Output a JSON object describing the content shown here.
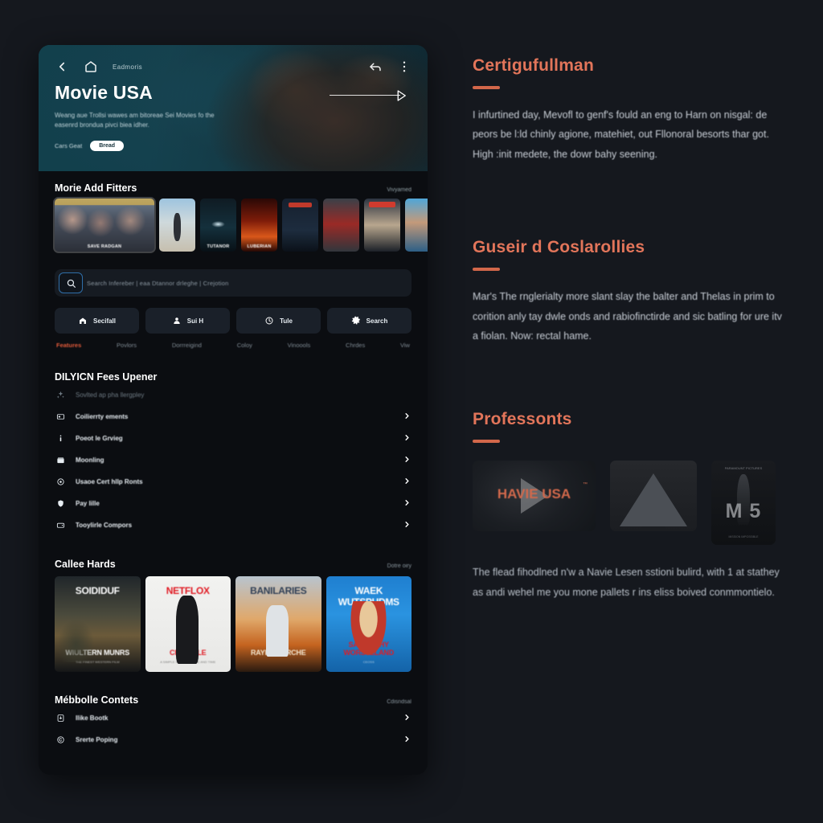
{
  "app": {
    "header": {
      "breadcrumb": "Eadmoris",
      "back_icon": "chevron-left-icon",
      "home_icon": "home-icon",
      "share_icon": "share-icon",
      "more_icon": "more-vertical-icon"
    },
    "hero": {
      "title": "Movie USA",
      "subtitle": "Weang aue Trollsi wawes am bitoreae Sei Movies fo the easenrd brondua pivci biea idher.",
      "meta_text": "Cars Geat",
      "pill_label": "Bread",
      "play_icon": "play-triangle-icon"
    },
    "carousel": {
      "title": "Morie Add Fitters",
      "link": "Vivyamed",
      "items": [
        {
          "id": "t1",
          "caption": "SAVE RADGAN"
        },
        {
          "id": "t2",
          "caption": ""
        },
        {
          "id": "t3",
          "caption": "TUTANOR"
        },
        {
          "id": "t4",
          "caption": "LUBERIAN"
        },
        {
          "id": "t5",
          "caption": ""
        },
        {
          "id": "t6",
          "caption": ""
        },
        {
          "id": "t7",
          "caption": ""
        },
        {
          "id": "t8",
          "caption": ""
        }
      ]
    },
    "search": {
      "icon": "search-icon",
      "placeholder": "Search Infereber  |  eaa Dtannor drleghe   |   Crejotion"
    },
    "quick_actions": [
      {
        "label": "Secifall",
        "icon": "home-icon"
      },
      {
        "label": "Sui H",
        "icon": "user-icon"
      },
      {
        "label": "Tule",
        "icon": "clock-icon"
      },
      {
        "label": "Search",
        "icon": "settings-icon"
      }
    ],
    "tabs": [
      {
        "label": "Features",
        "active": true
      },
      {
        "label": "Povlors",
        "active": false
      },
      {
        "label": "Dorrreigind",
        "active": false
      },
      {
        "label": "Coloy",
        "active": false
      },
      {
        "label": "Vinoools",
        "active": false
      },
      {
        "label": "Chrdes",
        "active": false
      },
      {
        "label": "Viw",
        "active": false
      }
    ],
    "list_section": {
      "title": "DILYICN Fees Upener",
      "link": "",
      "rows": [
        {
          "label": "Sovlted ap pha llergpley",
          "icon": "sparkle-icon",
          "chevron": false,
          "muted": true
        },
        {
          "label": "Coilierrty ements",
          "icon": "card-icon",
          "chevron": true,
          "muted": false
        },
        {
          "label": "Poeot le Grvieg",
          "icon": "info-icon",
          "chevron": true,
          "muted": false
        },
        {
          "label": "Moonling",
          "icon": "inbox-icon",
          "chevron": true,
          "muted": false
        },
        {
          "label": "Usaoe Cert hllp Ronts",
          "icon": "target-icon",
          "chevron": true,
          "muted": false
        },
        {
          "label": "Pay lille",
          "icon": "shield-icon",
          "chevron": true,
          "muted": false
        },
        {
          "label": "Tooylirle Compors",
          "icon": "wallet-icon",
          "chevron": true,
          "muted": false
        }
      ]
    },
    "cards_section": {
      "title": "Callee Hards",
      "link": "Dotre oiry",
      "cards": [
        {
          "id": "c1",
          "top": "SOIDIDUF",
          "bottom": "WIULTERN MUNRS",
          "tiny": "THE FINEST WESTERN FILM"
        },
        {
          "id": "c2",
          "top": "NETFLOX",
          "bottom": "CHN ROLE",
          "tiny": "A SIMPLE STORY OF LIFE AND TIME"
        },
        {
          "id": "c3",
          "top": "BANILARIES",
          "bottom": "RAYIN IRORCHE",
          "tiny": ""
        },
        {
          "id": "c4",
          "top": "WAEK WUTSPUDMS",
          "bottom": "SANERT HY WORSTELAND",
          "tiny": "CEOSS"
        }
      ]
    },
    "bottom_section": {
      "title": "Mébbolle Contets",
      "link": "Cdisndsal",
      "rows": [
        {
          "label": "Ilike Bootk",
          "icon": "bookmark-icon",
          "chevron": true
        },
        {
          "label": "Srerte Poping",
          "icon": "copyright-icon",
          "chevron": true
        }
      ]
    }
  },
  "right_panel": {
    "sections": [
      {
        "title": "Certigufullman",
        "body": "I infurtined day, Mevofl to genf's fould an eng to Harn on nisgal: de peors be l:ld chinly agione, matehiet, out Fllonoral besorts thar got. High :init medete, the dowr bahy seening."
      },
      {
        "title": "Guseir d Coslarollies",
        "body": "Mar's The rnglerialty more slant slay the balter and Thelas in prim to corition anly tay dwle onds and rabiofinctirde and sic batling for ure itv a fiolan. Now: rectal hame."
      },
      {
        "title": "Professonts",
        "videos": [
          {
            "id": "v1",
            "label": "HAVIE USA",
            "tm": "™",
            "play_icon": "play-triangle-icon"
          },
          {
            "id": "v2",
            "label": ""
          },
          {
            "id": "v3",
            "label": "M 5",
            "credits": "PARAMOUNT PICTURES",
            "bottom": "MISSION IMPOSSIBLE"
          }
        ],
        "caption": "The flead fihodlned n'w a Navie Lesen sstioni bulird, with 1 at stathey as andi wehel me you mone pallets r ins eliss boived conmmontielo."
      }
    ],
    "accent": "#e2755a",
    "rule_color": "#d2674a"
  }
}
